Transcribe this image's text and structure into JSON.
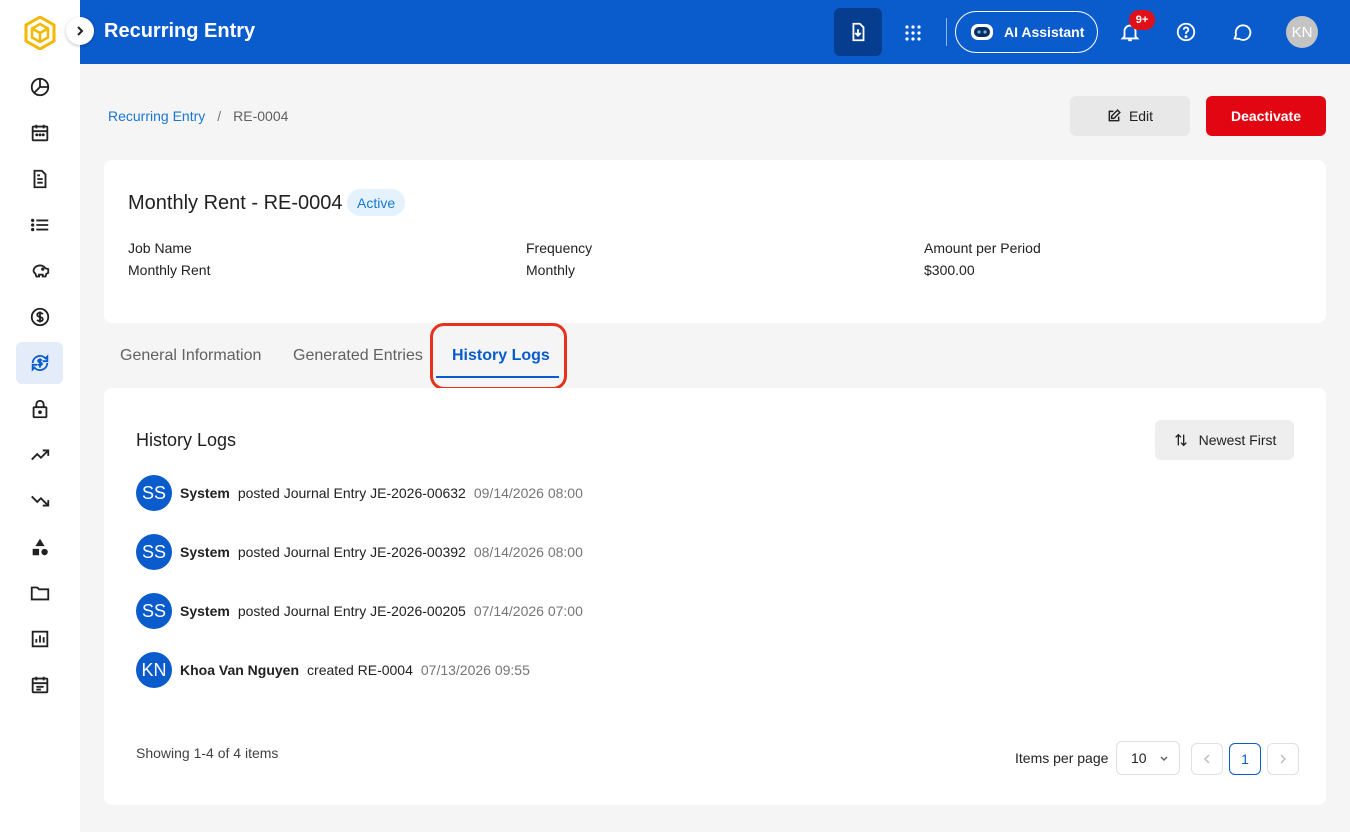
{
  "colors": {
    "primary": "#0a5bcc",
    "danger": "#e20613",
    "highlight": "#e8301c",
    "logo": "#f5b800"
  },
  "sidebar": {
    "icons": [
      "dashboard-pie-icon",
      "calendar-icon",
      "document-icon",
      "list-icon",
      "piggy-bank-icon",
      "dollar-circle-icon",
      "recurring-dollar-icon",
      "lock-icon",
      "trending-up-icon",
      "trending-down-icon",
      "shapes-icon",
      "folder-icon",
      "bar-chart-icon",
      "schedule-icon"
    ],
    "active_index": 6
  },
  "topbar": {
    "title": "Recurring Entry",
    "ai_label": "AI Assistant",
    "notification_count": "9+",
    "avatar_initials": "KN"
  },
  "breadcrumb": {
    "parent": "Recurring Entry",
    "separator": "/",
    "current": "RE-0004"
  },
  "actions": {
    "edit_label": "Edit",
    "deactivate_label": "Deactivate"
  },
  "summary": {
    "title": "Monthly Rent - RE-0004",
    "status": "Active",
    "fields": [
      {
        "label": "Job Name",
        "value": "Monthly Rent"
      },
      {
        "label": "Frequency",
        "value": "Monthly"
      },
      {
        "label": "Amount per Period",
        "value": "$300.00"
      }
    ]
  },
  "tabs": [
    {
      "label": "General Information"
    },
    {
      "label": "Generated Entries"
    },
    {
      "label": "History Logs"
    }
  ],
  "history": {
    "title": "History Logs",
    "sort_label": "Newest First",
    "logs": [
      {
        "initials": "SS",
        "actor": "System",
        "action": "posted Journal Entry JE-2026-00632",
        "time": "09/14/2026 08:00"
      },
      {
        "initials": "SS",
        "actor": "System",
        "action": "posted Journal Entry JE-2026-00392",
        "time": "08/14/2026 08:00"
      },
      {
        "initials": "SS",
        "actor": "System",
        "action": "posted Journal Entry JE-2026-00205",
        "time": "07/14/2026 07:00"
      },
      {
        "initials": "KN",
        "actor": "Khoa Van Nguyen",
        "action": "created RE-0004",
        "time": "07/13/2026 09:55"
      }
    ],
    "showing": "Showing 1-4 of 4 items",
    "items_per_page_label": "Items per page",
    "items_per_page": "10",
    "current_page": "1"
  }
}
